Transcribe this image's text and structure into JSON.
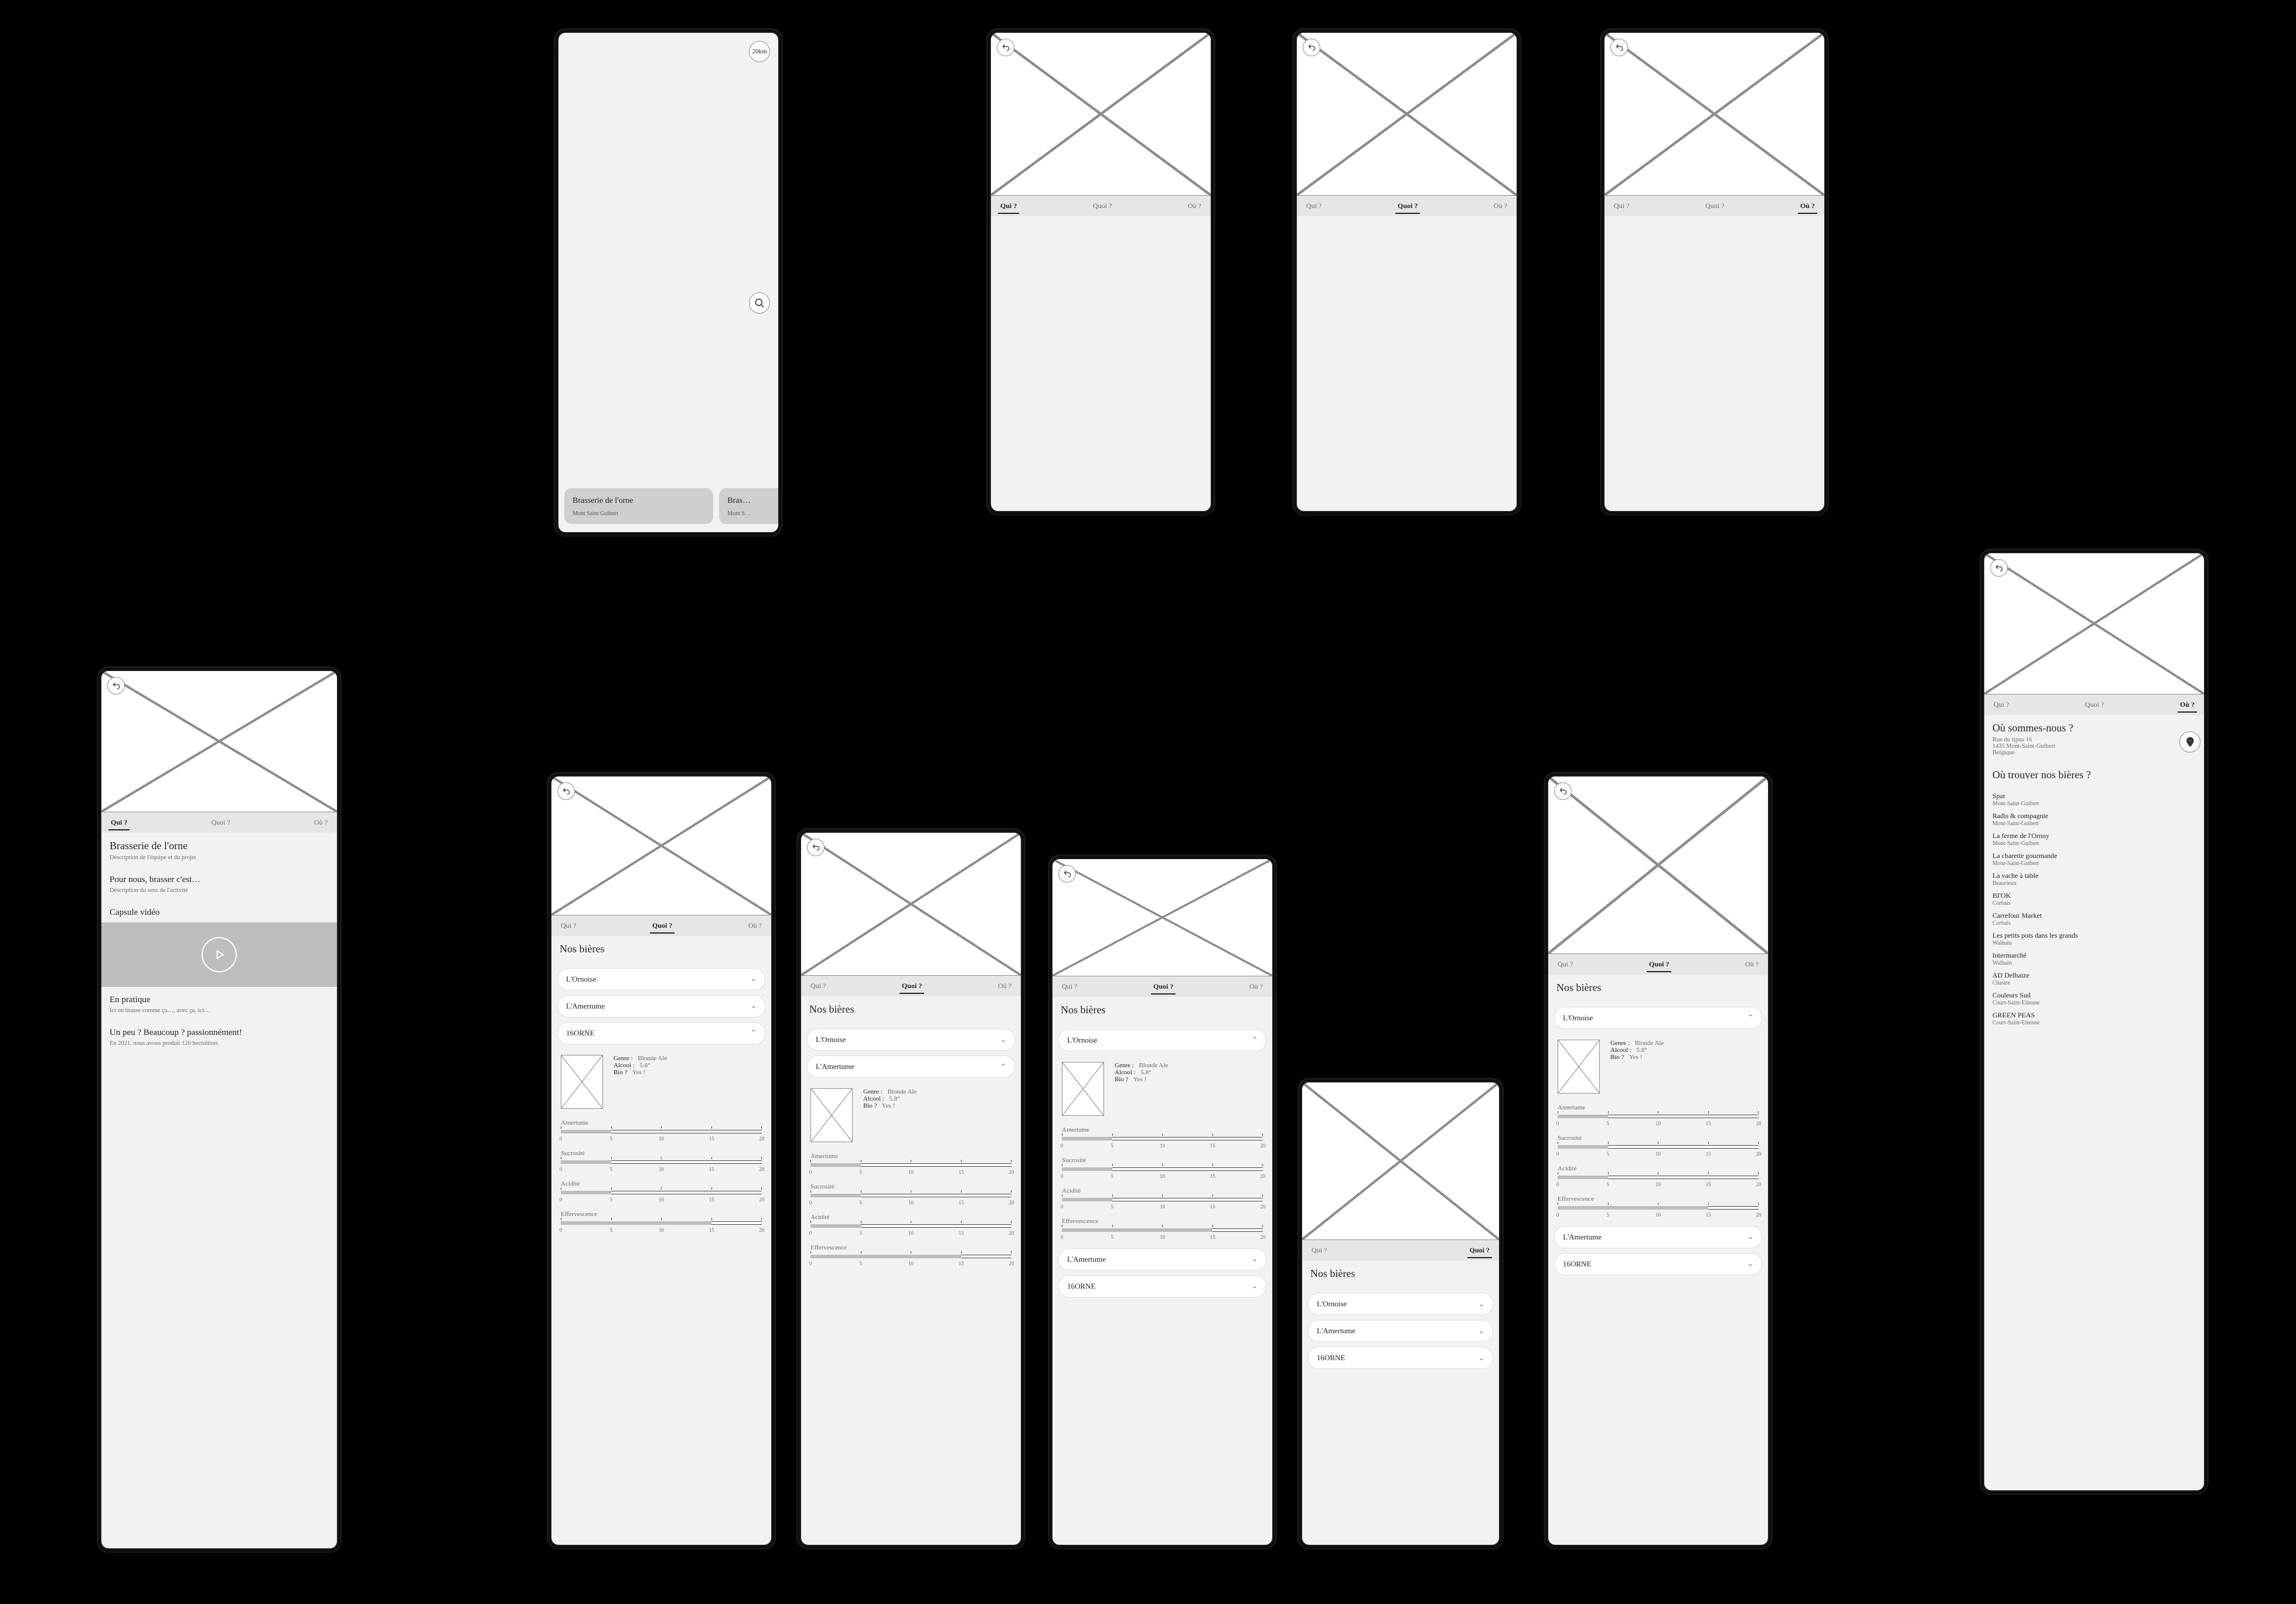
{
  "tabs": {
    "who": "Qui ?",
    "what": "Quoi ?",
    "where": "Où ?"
  },
  "screen_map": {
    "distance_badge": "20km",
    "cards": [
      {
        "name": "Brasserie de l'orne",
        "city": "Mont Saint Guibert"
      },
      {
        "name": "Bras…",
        "city": "Mont S…"
      }
    ]
  },
  "screen_who_detail": {
    "heading": "Brasserie de l'orne",
    "heading_sub": "Déscription de l'équipe et du projet",
    "sec2_title": "Pour nous, brasser c'est…",
    "sec2_sub": "Déscription du sens de l'activité",
    "video_title": "Capsule vidéo",
    "sec4_title": "En pratique",
    "sec4_sub": "Ici on brasse comme ça…, avec ça, ici…",
    "sec5_title": "Un peu ? Beaucoup ? passionnément!",
    "sec5_sub": "En 2021, nous avons produit 120 hectolitres"
  },
  "beers": {
    "heading": "Nos bières",
    "items": [
      {
        "name": "L'Ornoise"
      },
      {
        "name": "L'Amertume"
      },
      {
        "name": "16ORNE"
      }
    ],
    "detail": {
      "genre_label": "Genre :",
      "genre": "Blonde Ale",
      "alcool_label": "Alcool :",
      "alcool": "5.8°",
      "bio_label": "Bio ?",
      "bio": "Yes !",
      "meters": [
        {
          "label": "Amertume",
          "value": 5,
          "max": 20,
          "ticks": [
            0,
            5,
            10,
            15,
            20
          ]
        },
        {
          "label": "Sucrosité",
          "value": 5,
          "max": 20,
          "ticks": [
            0,
            5,
            10,
            15,
            20
          ]
        },
        {
          "label": "Acidité",
          "value": 5,
          "max": 20,
          "ticks": [
            0,
            5,
            10,
            15,
            20
          ]
        },
        {
          "label": "Effervescence",
          "value": 15,
          "max": 20,
          "ticks": [
            0,
            5,
            10,
            15,
            20
          ]
        }
      ]
    }
  },
  "screen_where": {
    "heading1": "Où sommes-nous ?",
    "addr1": "Rue du ripau 16",
    "addr2": "1435 Mont-Saint-Guibert",
    "addr3": "Belgique",
    "heading2": "Où trouver nos bières ?",
    "stores": [
      {
        "n": "Spar",
        "c": "Mont-Saint-Guibert"
      },
      {
        "n": "Radis & compagnie",
        "c": "Mont-Saint-Guibert"
      },
      {
        "n": "La ferme de l'Ornoy",
        "c": "Mont-Saint-Guibert"
      },
      {
        "n": "La charette gourmande",
        "c": "Mont-Saint-Guibert"
      },
      {
        "n": "La vache à table",
        "c": "Beaurieux"
      },
      {
        "n": "BI'OK",
        "c": "Corbais"
      },
      {
        "n": "Carrefour Market",
        "c": "Corbais"
      },
      {
        "n": "Les petits pots dans les grands",
        "c": "Walhain"
      },
      {
        "n": "Intermarché",
        "c": "Walhain"
      },
      {
        "n": "AD Delhaize",
        "c": "Chastre"
      },
      {
        "n": "Couleurs Sud",
        "c": "Court-Saint-Etienne"
      },
      {
        "n": "GREEN PEAS",
        "c": "Court-Saint-Etienne"
      }
    ]
  }
}
